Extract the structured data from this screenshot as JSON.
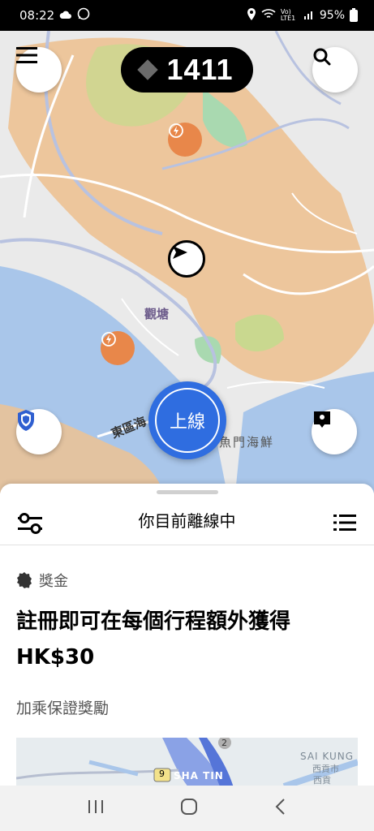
{
  "status": {
    "time": "08:22",
    "signal_text": "Vo) LTE1",
    "battery": "95%"
  },
  "top": {
    "score": "1411"
  },
  "map": {
    "labels": [
      "觀塘",
      "東區海",
      "魚門海鮮"
    ]
  },
  "go_online_label": "上線",
  "sheet": {
    "title": "你目前離線中"
  },
  "promo": {
    "tag": "獎金",
    "title": "註冊即可在每個行程額外獲得 HK$30",
    "subtitle": "加乘保證獎勵",
    "map_labels": [
      "SAI KUNG",
      "西貢市",
      "西貢",
      "SHA TIN",
      "9",
      "2"
    ]
  },
  "colors": {
    "accent": "#2f6de0",
    "surge": "#e8874a",
    "map_orange": "#edc293",
    "water": "#a9c6ea"
  },
  "icons": [
    "cloud-icon",
    "whatsapp-icon",
    "location-icon",
    "wifi-icon",
    "signal-icon",
    "battery-icon",
    "menu-icon",
    "search-icon",
    "diamond-icon",
    "lightning-icon",
    "navigation-arrow-icon",
    "shield-icon",
    "map-pin-icon",
    "filter-icon",
    "list-icon",
    "badge-icon",
    "recent-apps-icon",
    "home-icon",
    "back-icon"
  ]
}
